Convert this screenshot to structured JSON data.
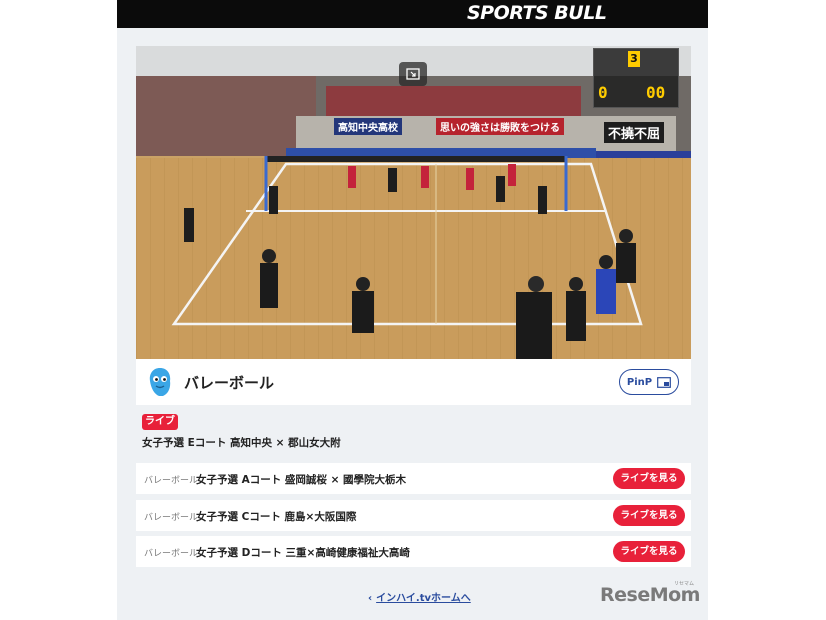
{
  "header": {
    "brand": "SPORTS BULL"
  },
  "video": {
    "scoreboard": {
      "set": "3",
      "score_left": "0",
      "score_right": "00"
    },
    "banners": [
      "高知中央高校",
      "思いの強さは勝敗をつける",
      "不撓不屈"
    ]
  },
  "title_bar": {
    "sport": "バレーボール",
    "pinp_label": "PinP"
  },
  "now_live": {
    "badge": "ライブ",
    "title": "女子予選 Eコート 高知中央 × 郡山女大附"
  },
  "matches": [
    {
      "sport": "バレーボール",
      "title": "女子予選 Aコート 盛岡誠桜 × 國學院大栃木",
      "button": "ライブを見る"
    },
    {
      "sport": "バレーボール",
      "title": "女子予選 Cコート 鹿島×大阪国際",
      "button": "ライブを見る"
    },
    {
      "sport": "バレーボール",
      "title": "女子予選 Dコート 三重×高崎健康福祉大高崎",
      "button": "ライブを見る"
    }
  ],
  "footer": {
    "home_link": "インハイ.tvホームへ",
    "logo": "ReseMom",
    "logo_kana": "リセマム"
  },
  "colors": {
    "accent_red": "#e8213a",
    "link_blue": "#2a4c9e",
    "header_black": "#0b0b0b"
  }
}
